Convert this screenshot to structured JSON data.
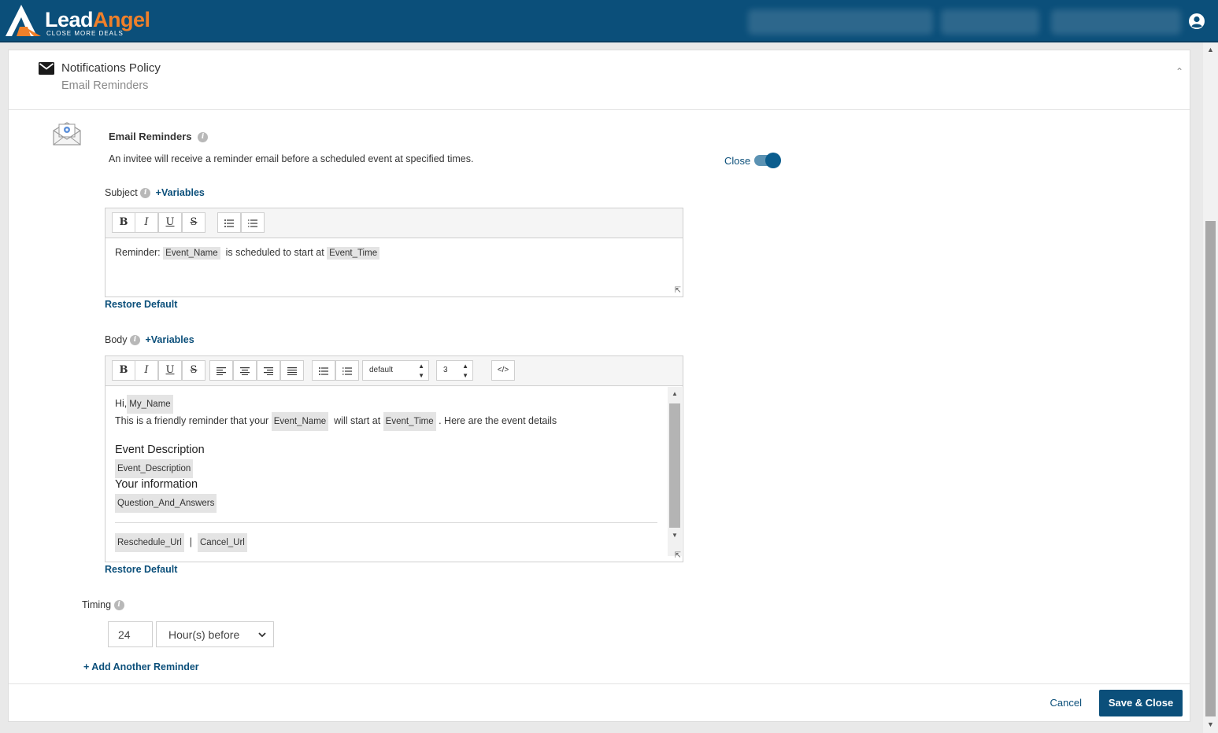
{
  "app": {
    "brand_lead": "Lead",
    "brand_angel": "Angel",
    "tagline": "CLOSE MORE DEALS"
  },
  "header": {
    "title": "Notifications Policy",
    "subtitle": "Email Reminders"
  },
  "section": {
    "title": "Email Reminders",
    "description": "An invitee will receive a reminder email before a scheduled event at specified times.",
    "toggle_label": "Close"
  },
  "subject": {
    "label": "Subject",
    "variables_link": "+Variables",
    "text_prefix": "Reminder:",
    "var1": "Event_Name",
    "text_mid": "is scheduled to start at",
    "var2": "Event_Time",
    "restore": "Restore Default"
  },
  "body": {
    "label": "Body",
    "variables_link": "+Variables",
    "font_select": "default",
    "size_select": "3",
    "greeting": "Hi,",
    "my_name_var": "My_Name",
    "line1_a": "This is a friendly reminder that your",
    "event_name_var": "Event_Name",
    "line1_b": "will start at",
    "event_time_var": "Event_Time",
    "line1_c": ". Here are the event details",
    "heading1": "Event Description",
    "desc_var": "Event_Description",
    "heading2": "Your information",
    "qa_var": "Question_And_Answers",
    "reschedule_var": "Reschedule_Url",
    "separator": "|",
    "cancel_var": "Cancel_Url",
    "restore": "Restore Default"
  },
  "timing": {
    "label": "Timing",
    "value": "24",
    "unit": "Hour(s) before",
    "add_link": "+ Add Another Reminder"
  },
  "footer": {
    "cancel": "Cancel",
    "save": "Save & Close"
  },
  "toolbar_icons": {
    "bold": "B",
    "italic": "I",
    "underline": "U",
    "strike": "S",
    "code": "</>"
  }
}
